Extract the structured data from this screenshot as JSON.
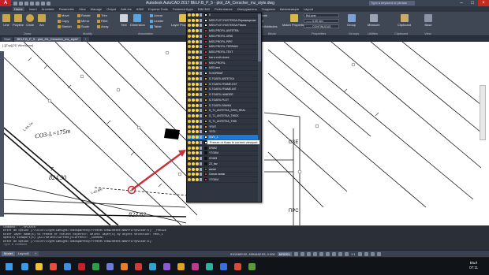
{
  "titlebar": {
    "title": "Autodesk AutoCAD 2017   BELF.B_P_5 - plot_ZA_Cerscher_mz_style.dwg",
    "search_placeholder": "Type a keyword or phrase",
    "logo": "A"
  },
  "ribbon_tabs": [
    "Home",
    "Insert",
    "Annotate",
    "Parametric",
    "View",
    "Manage",
    "Output",
    "Add-ins",
    "A360",
    "Express Tools",
    "Featured Apps",
    "BIM 360",
    "Performance",
    "Инструменты",
    "Геодезия",
    "Канализация",
    "Layout"
  ],
  "ribbon": {
    "draw_buttons": [
      "Line",
      "Polyline",
      "Circle",
      "Arc"
    ],
    "modify_items": [
      "Move",
      "Rotate",
      "Trim",
      "Copy",
      "Mirror",
      "Fillet",
      "Stretch",
      "Scale",
      "Array"
    ],
    "annotation_items": [
      "Text",
      "Dimension",
      "Linear",
      "Leader",
      "Table"
    ],
    "layer_props": "Layer Properties",
    "layer_combo": "0",
    "right_buttons": [
      "Create",
      "Edit",
      "Edit Attributes",
      "Match Properties",
      "Measure",
      "Group",
      "Utilities",
      "Clipboard",
      "View",
      "Base"
    ],
    "prop_combo_1": "ByLayer",
    "prop_combo_2": "—— 0.00 mm",
    "prop_combo_3": "—— CONTINUOUS",
    "panel_labels": [
      "Draw",
      "Modify",
      "Annotation",
      "Layers",
      "Block",
      "Properties",
      "Groups",
      "Utilities",
      "Clipboard",
      "View"
    ]
  },
  "document_tabs": [
    "Start",
    "BELF.B_P_5 - plot_ZA_Cerscher_mz_style*",
    "+"
  ],
  "viewport_label": "[-][Top][2D Wireframe]",
  "drawing": {
    "labels": [
      "CO3-L=175m",
      "L-2A.7m",
      "L-42.6m",
      "7",
      "824.30",
      "823.62",
      "CSE",
      "ПРС"
    ]
  },
  "layers": [
    {
      "name": "0",
      "color": "#ffffff"
    },
    {
      "name": "MSS-PLOT-FASTESSA-Перемещение",
      "color": "#ffffff"
    },
    {
      "name": "MSS-PLOT-FASTESSA Plavna",
      "color": "#ffffff"
    },
    {
      "name": "MSS-PROFIL-ANTETRA",
      "color": "#e03b3b"
    },
    {
      "name": "MSS-PROFIL-GRID",
      "color": "#e03b3b"
    },
    {
      "name": "MSS-PROFIL-PIPE",
      "color": "#e03b3b"
    },
    {
      "name": "MSS-PROFIL-TERRAIN",
      "color": "#e03b3b"
    },
    {
      "name": "MSS-PROFIL-TEXT",
      "color": "#e03b3b"
    },
    {
      "name": "tow a enth clores",
      "color": "#e03b3b"
    },
    {
      "name": "MSS-PROFIL",
      "color": "#e03b3b"
    },
    {
      "name": "MSS-text",
      "color": "#31a7e6"
    },
    {
      "name": "S-NORMAT",
      "color": "#e8e8e8"
    },
    {
      "name": "S-TGARX-ANTETKA",
      "color": "#f0a020"
    },
    {
      "name": "S-TGARX-FRAME-EXT",
      "color": "#f0a020"
    },
    {
      "name": "S-TGARX-FRAME-INT",
      "color": "#f0a020"
    },
    {
      "name": "S-TGARX-HANDER",
      "color": "#f0a020"
    },
    {
      "name": "S-TGARX-PLOT",
      "color": "#f0a020"
    },
    {
      "name": "S-TGARX-RAMKA",
      "color": "#f0a020"
    },
    {
      "name": "S_T1_ANTETKA_SIGN_REAL",
      "color": "#f0a020"
    },
    {
      "name": "S_T1_ANTETKA_THICK",
      "color": "#f0a020"
    },
    {
      "name": "S_T1_ANTETKA_THIN",
      "color": "#f0a020"
    },
    {
      "name": "YFMT",
      "color": "#f0a020"
    },
    {
      "name": "YES1",
      "color": "#ffffff"
    },
    {
      "name": "SWV_1",
      "color": "#ffffff"
    },
    {
      "name": "DRW1",
      "color": "#ffffff"
    },
    {
      "name": "DRW2",
      "color": "#111111"
    },
    {
      "name": "YTGIKA",
      "color": "#111111"
    },
    {
      "name": "ZGADI",
      "color": "#111111"
    },
    {
      "name": "ZZ_fav",
      "color": "#111111"
    },
    {
      "name": "канал",
      "color": "#2d9e3a"
    },
    {
      "name": "Основ линии",
      "color": "#e03b3b"
    },
    {
      "name": "YTGIKA",
      "color": "#e03b3b"
    }
  ],
  "highlighted_layer_index": 23,
  "tooltip": "Freeze or thaw in current viewport",
  "command_lines": [
    "Command: '_.VPLAYER",
    "Enter an option [?/Color/Ltype/LWeight/TRansparency/Freeze/Thaw/Reset/Newfrz/Vpvisdflt]: _FREEZE",
    "Enter layer name(s) to freeze or <select objects>: Select layer(s) by object selection: <MSV_1",
    "Specify viewport(s) [All/Select/Current]<Current>: _CURRENT",
    "Enter an option [?/Color/Ltype/LWeight/TRansparency/Freeze/Thaw/Reset/Newfrz/Vpvisdflt]:"
  ],
  "command_prompt": "Type a command",
  "layout_tabs": [
    "Model",
    "Layout1",
    "+"
  ],
  "status": {
    "coords": "9101583.02, 4594482.53, 0.000",
    "model": "MODEL",
    "scale": "1:1"
  },
  "taskbar": {
    "time": "07:11",
    "lang": "БЪЛ",
    "app_colors": [
      "#3a9ae8",
      "#f2c230",
      "#e94d3a",
      "#3e8ee0",
      "#c8202b",
      "#2e9e48",
      "#6c7bd6",
      "#e87e2a",
      "#d23a3a",
      "#2fa3d6",
      "#8c5ad6",
      "#e0a420",
      "#c03a8c",
      "#30b0a0",
      "#3a6ee0",
      "#d84a3a",
      "#5a9a3a"
    ]
  },
  "accent_color": "#1d79d6",
  "arrow_color": "#c8303a"
}
